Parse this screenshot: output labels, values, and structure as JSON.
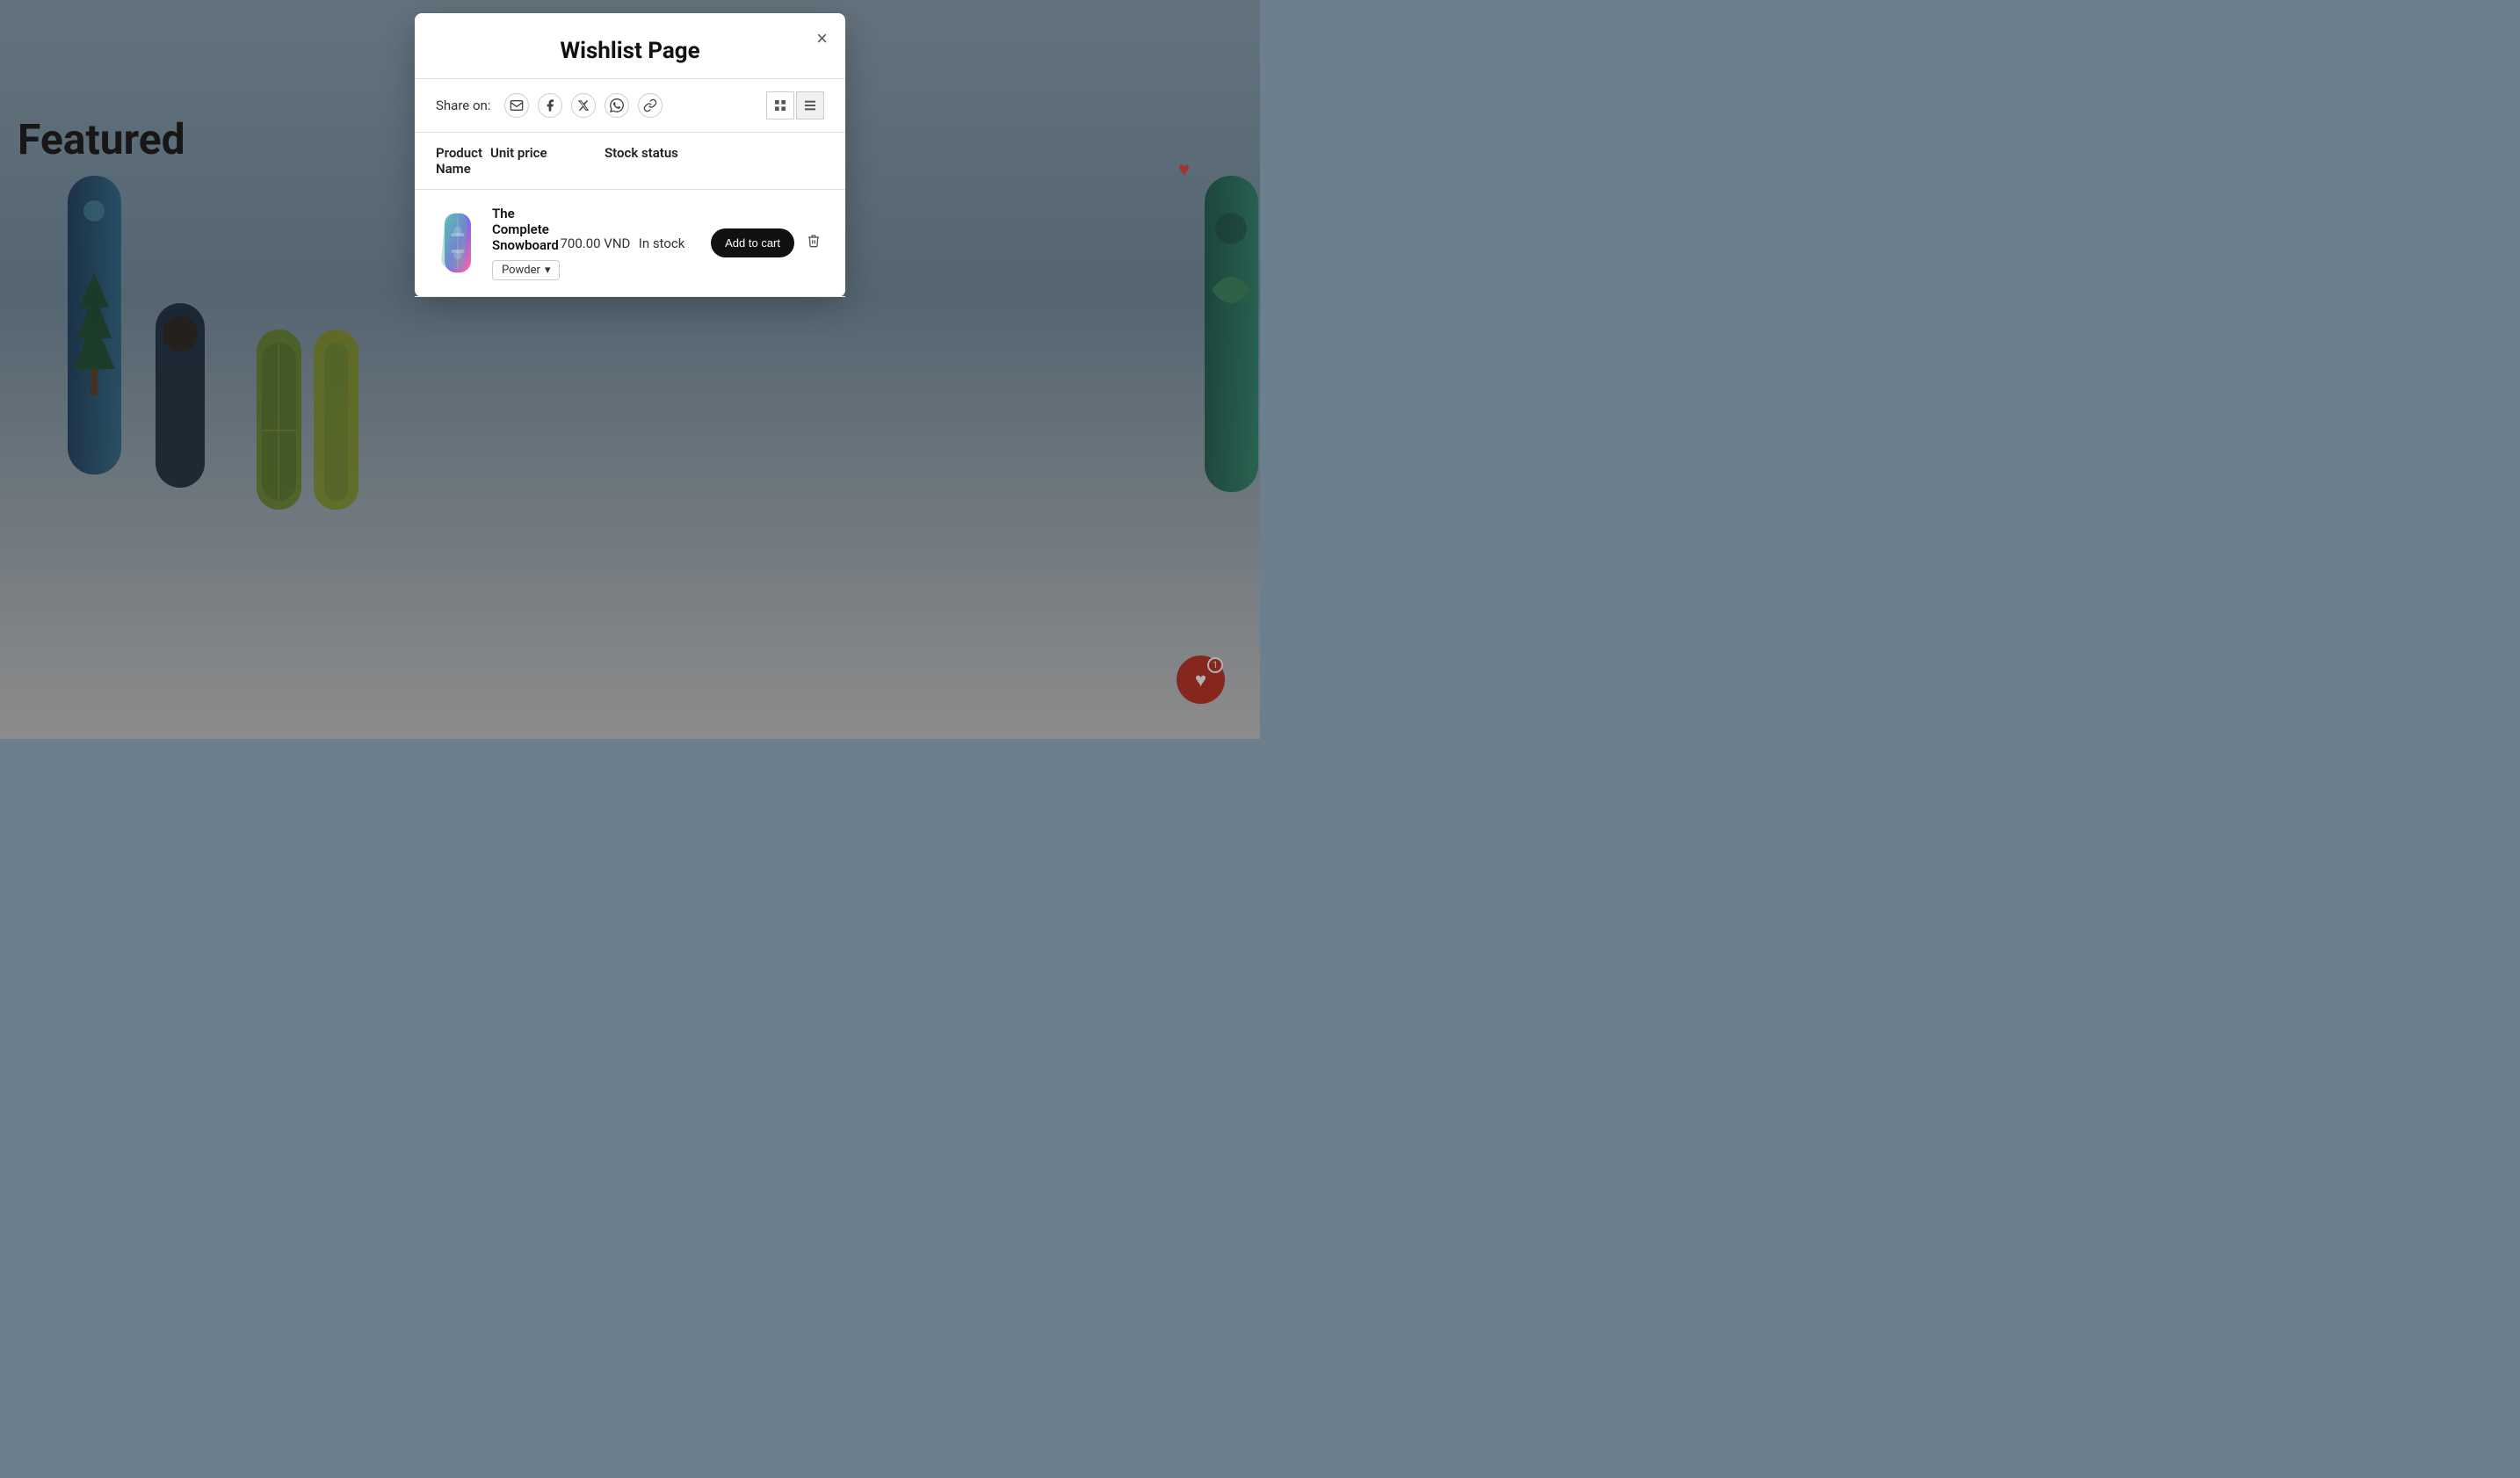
{
  "background": {
    "featured_text": "Featured"
  },
  "modal": {
    "title": "Wishlist Page",
    "close_label": "×",
    "share": {
      "label": "Share on:",
      "icons": [
        {
          "name": "email-icon",
          "symbol": "✉",
          "label": "Email"
        },
        {
          "name": "facebook-icon",
          "symbol": "f",
          "label": "Facebook"
        },
        {
          "name": "twitter-x-icon",
          "symbol": "𝕏",
          "label": "Twitter/X"
        },
        {
          "name": "whatsapp-icon",
          "symbol": "◎",
          "label": "WhatsApp"
        },
        {
          "name": "link-icon",
          "symbol": "🔗",
          "label": "Copy Link"
        }
      ]
    },
    "view_toggle": {
      "grid_label": "⊞",
      "list_label": "☰",
      "active": "list"
    },
    "table": {
      "headers": [
        {
          "key": "product",
          "label": "Product Name"
        },
        {
          "key": "price",
          "label": "Unit price"
        },
        {
          "key": "stock",
          "label": "Stock status"
        }
      ],
      "rows": [
        {
          "id": 1,
          "name": "The Complete Snowboard",
          "variant": "Powder",
          "price": "700.00 VND",
          "stock": "In stock",
          "add_to_cart_label": "Add to cart"
        }
      ]
    }
  },
  "wishlist_float": {
    "badge": "1"
  }
}
